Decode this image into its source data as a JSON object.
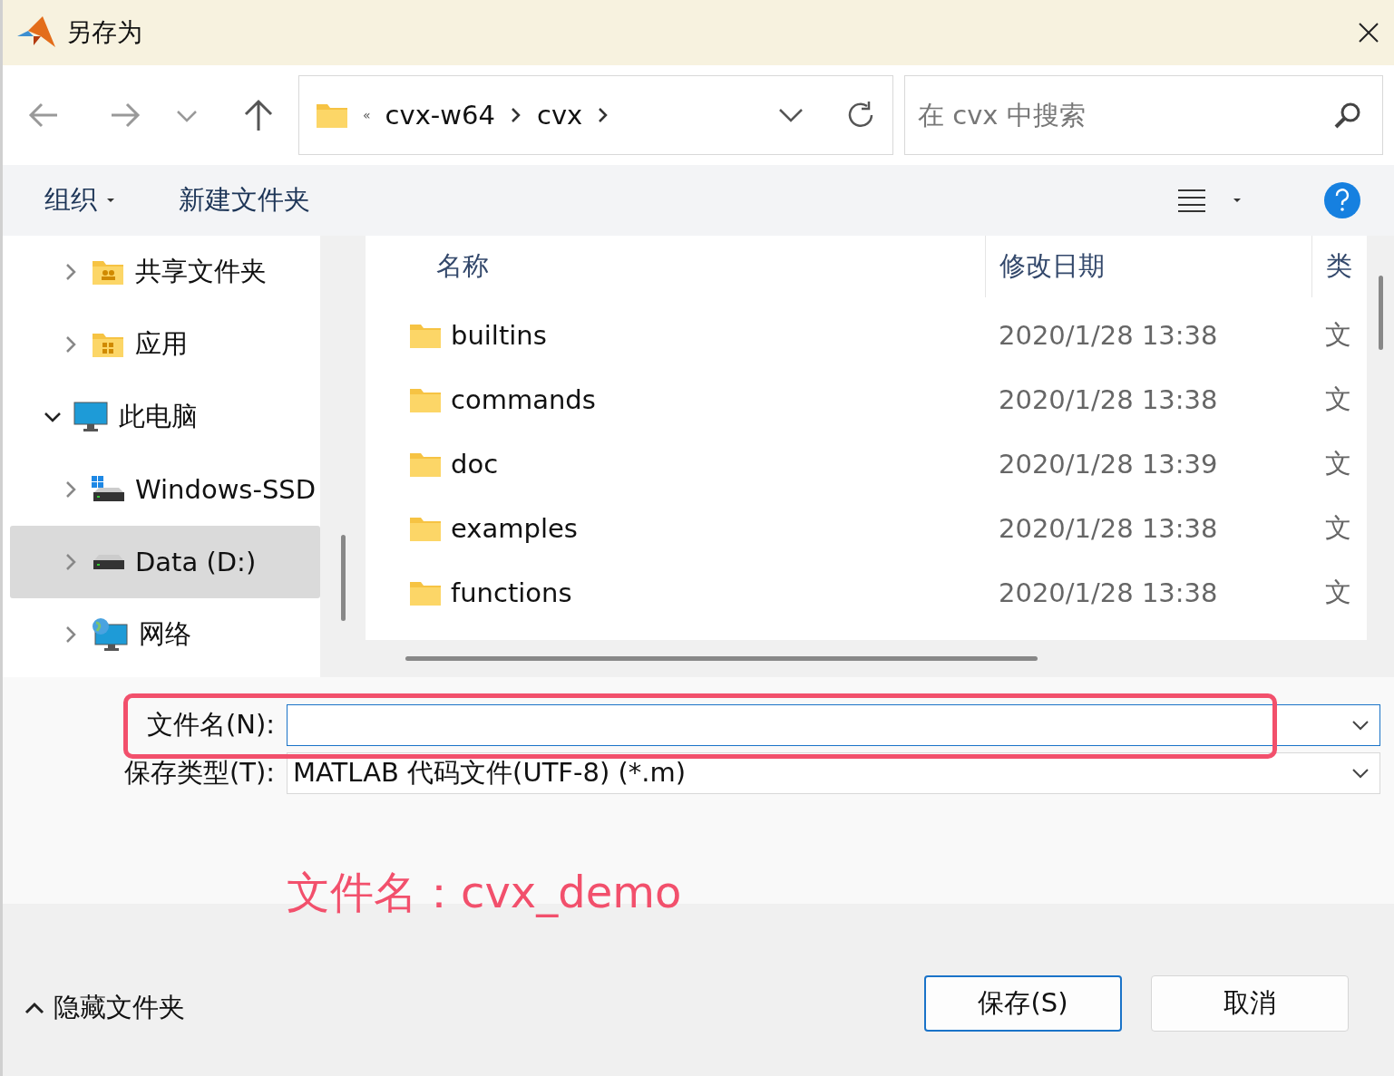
{
  "window": {
    "title": "另存为"
  },
  "address_bar": {
    "overflow": "«",
    "crumbs": [
      "cvx-w64",
      "cvx"
    ]
  },
  "search": {
    "placeholder": "在 cvx 中搜索"
  },
  "commands": [
    {
      "label": "组织",
      "dropdown": true
    },
    {
      "label": "新建文件夹",
      "dropdown": false
    }
  ],
  "nav_tree": [
    {
      "label": "共享文件夹",
      "kind": "shared",
      "expanded": false,
      "selected": false
    },
    {
      "label": "应用",
      "kind": "apps",
      "expanded": false,
      "selected": false
    },
    {
      "label": "此电脑",
      "kind": "pc",
      "expanded": true,
      "selected": false,
      "children": [
        {
          "label": "Windows-SSD",
          "kind": "windrive",
          "expanded": false,
          "selected": false
        },
        {
          "label": "Data (D:)",
          "kind": "drive",
          "expanded": false,
          "selected": true
        }
      ]
    },
    {
      "label": "网络",
      "kind": "network",
      "expanded": false,
      "selected": false
    }
  ],
  "file_list": {
    "columns": [
      "名称",
      "修改日期",
      "类"
    ],
    "rows": [
      {
        "name": "builtins",
        "date": "2020/1/28 13:38",
        "type": "文"
      },
      {
        "name": "commands",
        "date": "2020/1/28 13:38",
        "type": "文"
      },
      {
        "name": "doc",
        "date": "2020/1/28 13:39",
        "type": "文"
      },
      {
        "name": "examples",
        "date": "2020/1/28 13:38",
        "type": "文"
      },
      {
        "name": "functions",
        "date": "2020/1/28 13:38",
        "type": "文"
      }
    ]
  },
  "fields": [
    {
      "label": "文件名(N):",
      "focused": true
    },
    {
      "label": "保存类型(T):",
      "value": "MATLAB 代码文件(UTF-8) (*.m)",
      "focused": false
    }
  ],
  "annotation": {
    "text": "文件名：cvx_demo",
    "color": "#f2506c"
  },
  "hide_folders": {
    "label": "隐藏文件夹"
  },
  "buttons": [
    {
      "label": "保存(S)",
      "default": true
    },
    {
      "label": "取消",
      "default": false
    }
  ]
}
